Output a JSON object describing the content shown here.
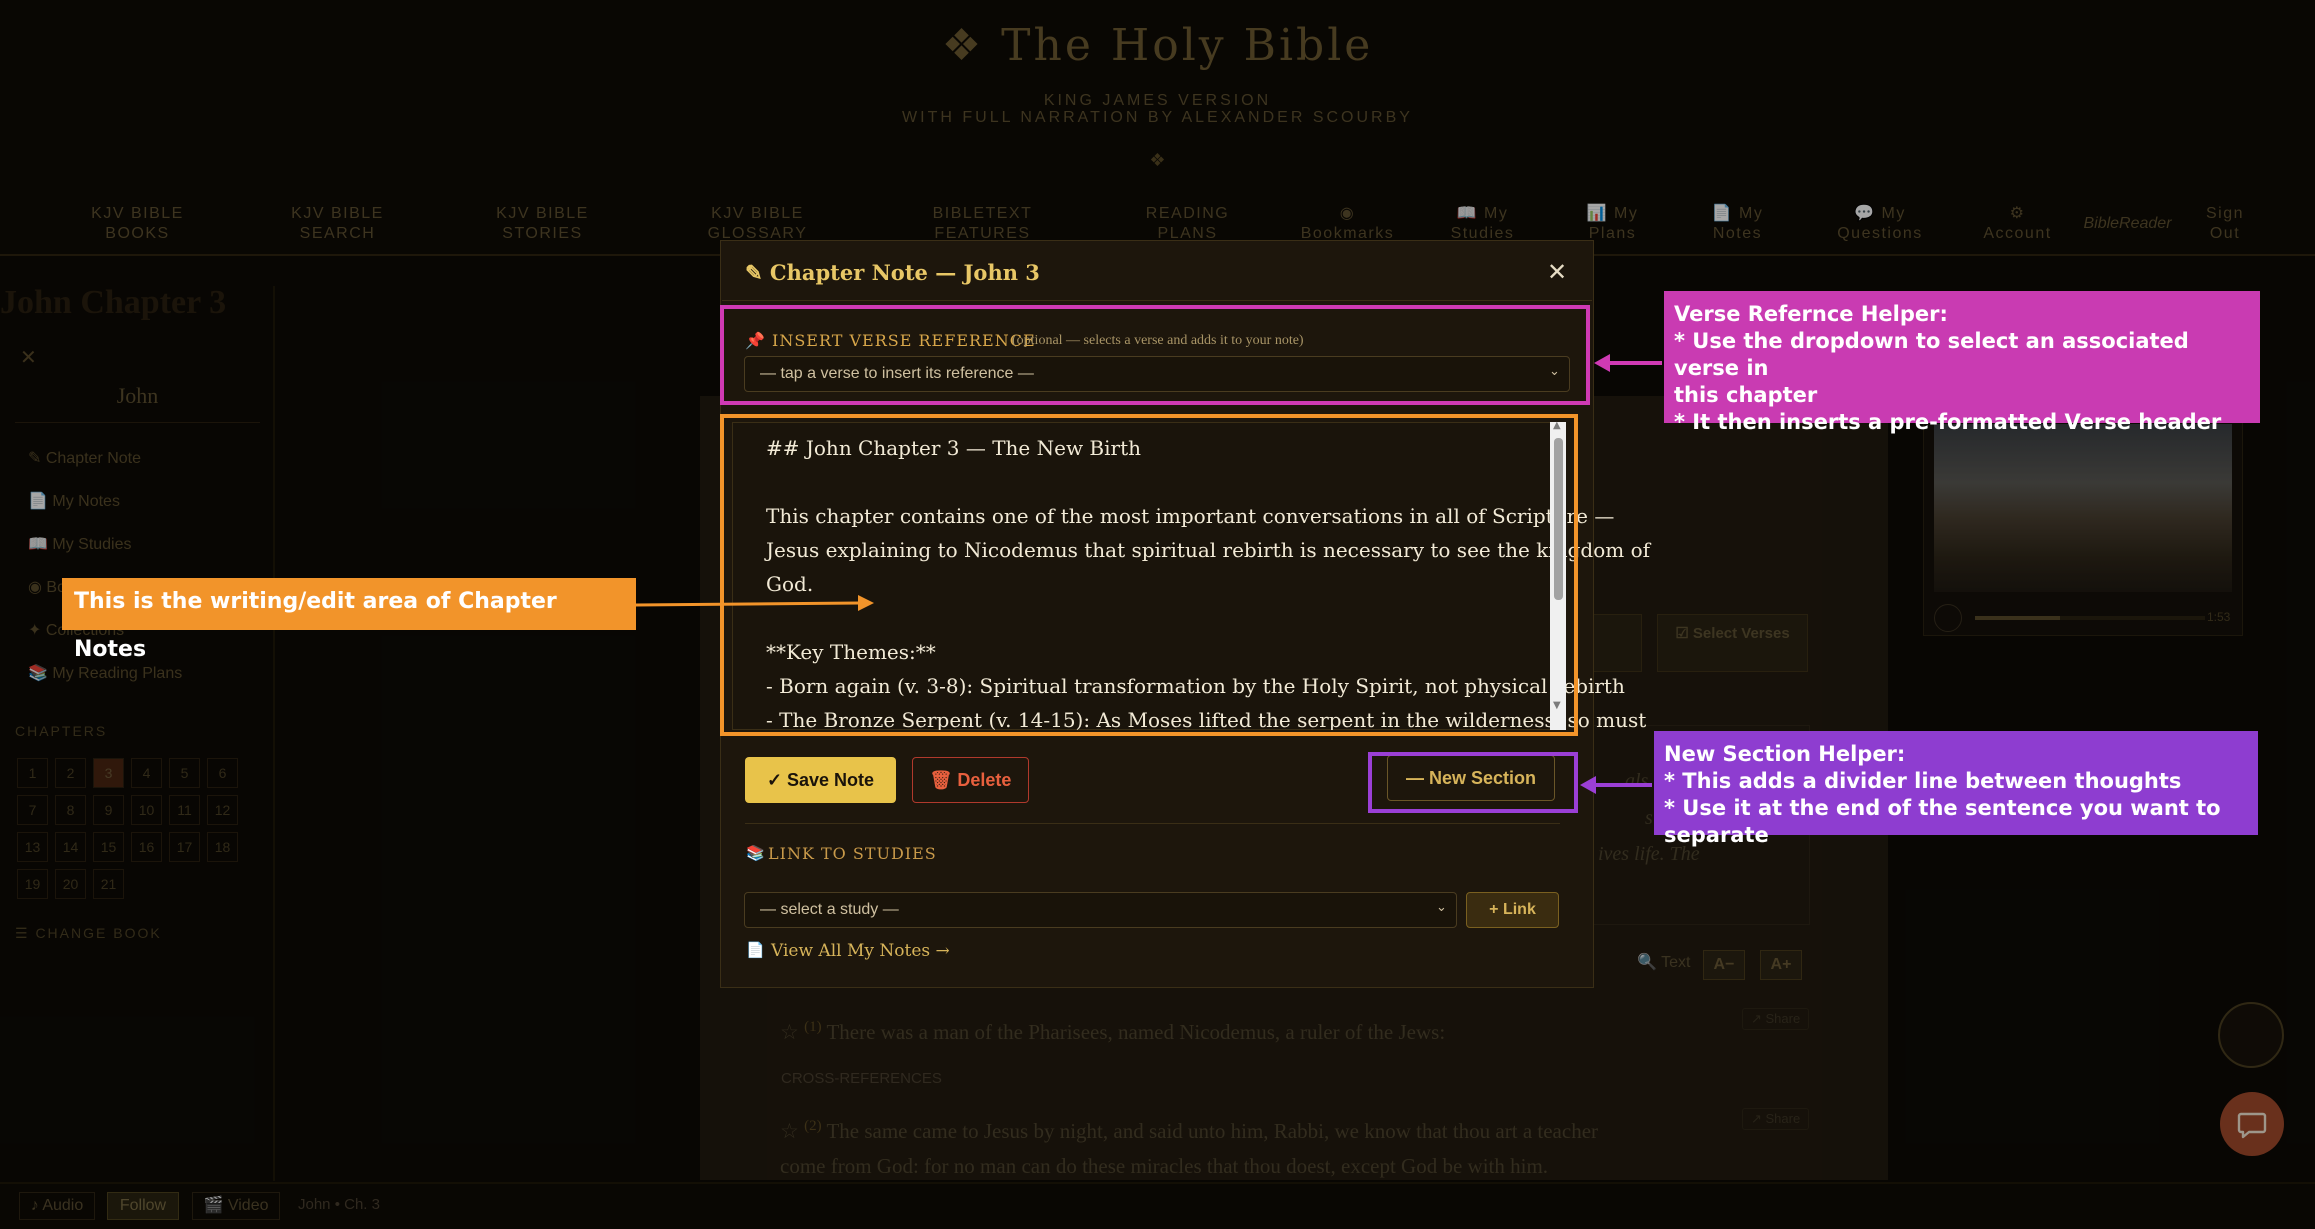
{
  "site": {
    "title": "The Holy Bible",
    "title_ornament": "❖",
    "subtitle1": "KING JAMES VERSION",
    "subtitle2": "WITH FULL NARRATION BY ALEXANDER SCOURBY",
    "divider_ornament": "❖"
  },
  "nav": [
    {
      "l1": "KJV BIBLE",
      "l2": "BOOKS"
    },
    {
      "l1": "KJV BIBLE",
      "l2": "SEARCH"
    },
    {
      "l1": "KJV BIBLE",
      "l2": "STORIES"
    },
    {
      "l1": "KJV BIBLE",
      "l2": "GLOSSARY"
    },
    {
      "l1": "BIBLETEXT",
      "l2": "FEATURES"
    },
    {
      "l1": "READING",
      "l2": "PLANS"
    },
    {
      "l1": "◉",
      "l2": "Bookmarks"
    },
    {
      "l1": "📖 My",
      "l2": "Studies"
    },
    {
      "l1": "📊 My",
      "l2": "Plans"
    },
    {
      "l1": "📄 My",
      "l2": "Notes"
    },
    {
      "l1": "💬 My",
      "l2": "Questions"
    },
    {
      "l1": "⚙",
      "l2": "Account"
    },
    {
      "l1": "BibleReader",
      "l2": ""
    },
    {
      "l1": "Sign",
      "l2": "Out"
    }
  ],
  "page_heading": "John Chapter 3",
  "sidebar": {
    "close": "✕",
    "book": "John",
    "links": [
      "✎ Chapter Note",
      "📄 My Notes",
      "📖 My Studies",
      "◉ Bo",
      "✦ Collections",
      "📚 My Reading Plans"
    ],
    "chapters_label": "CHAPTERS",
    "chapters": [
      "1",
      "2",
      "3",
      "4",
      "5",
      "6",
      "7",
      "8",
      "9",
      "10",
      "11",
      "12",
      "13",
      "14",
      "15",
      "16",
      "17",
      "18",
      "19",
      "20",
      "21"
    ],
    "active_chapter": "3",
    "change_book": "☰ CHANGE BOOK"
  },
  "content": {
    "select_verses": "☑ Select Verses",
    "behind_quote": [
      "als th",
      "s that",
      "ives life. The"
    ],
    "text_label": "🔍 Text",
    "font_smaller": "A−",
    "font_larger": "A+",
    "verse1_num": "(1)",
    "verse1": "There was a man of the Pharisees, named Nicodemus, a ruler of the Jews:",
    "cross_refs": "CROSS-REFERENCES",
    "verse2_num": "(2)",
    "verse2_line1": "The same came to Jesus by night, and said unto him, Rabbi, we know that thou art a teacher",
    "verse2_line2": "come from God: for no man can do these miracles that thou doest, except God be with him.",
    "share": "↗ Share",
    "star": "☆"
  },
  "video": {
    "time": "1:53",
    "progress": 0.37
  },
  "footer": {
    "audio": "♪ Audio",
    "follow": "Follow",
    "video": "🎬 Video",
    "location": "John • Ch. 3"
  },
  "modal": {
    "title": "✎ Chapter Note — John 3",
    "close": "✕",
    "ref_label": "📌 INSERT VERSE REFERENCE",
    "ref_hint": "(optional — selects a verse and adds it to your note)",
    "ref_placeholder": "— tap a verse to insert its reference —",
    "editor_lines": [
      "## John Chapter 3 — The New Birth",
      "",
      "This chapter contains one of the most important conversations in all of Scripture —",
      "Jesus explaining to Nicodemus that spiritual rebirth is necessary to see the kingdom of",
      "God.",
      "",
      "**Key Themes:**",
      "- Born again (v. 3-8): Spiritual transformation by the Holy Spirit, not physical rebirth",
      "- The Bronze Serpent (v. 14-15): As Moses lifted the serpent in the wilderness, so must"
    ],
    "save": "✓ Save Note",
    "delete": "🗑 Delete",
    "new_section": "— New Section",
    "studies_label": "LINK TO STUDIES",
    "studies_icon": "📚",
    "study_placeholder": "— select a study —",
    "link": "+ Link",
    "view_notes_icon": "📄",
    "view_notes": "View All My Notes →"
  },
  "annotations": {
    "verse_helper": {
      "title": "Verse Refernce Helper:",
      "lines": [
        "* Use the dropdown to select an associated verse in",
        "this chapter",
        "* It then inserts a pre-formatted  Verse header"
      ]
    },
    "edit_area": "This is the writing/edit area of Chapter Notes",
    "new_section_helper": {
      "title": "New Section Helper:",
      "lines": [
        "* This adds a divider line between thoughts",
        "* Use it at the end of the sentence you want to separate"
      ]
    },
    "colors": {
      "verse": "#c93bb2",
      "edit": "#f2942a",
      "new_section": "#8e3dd0"
    }
  }
}
